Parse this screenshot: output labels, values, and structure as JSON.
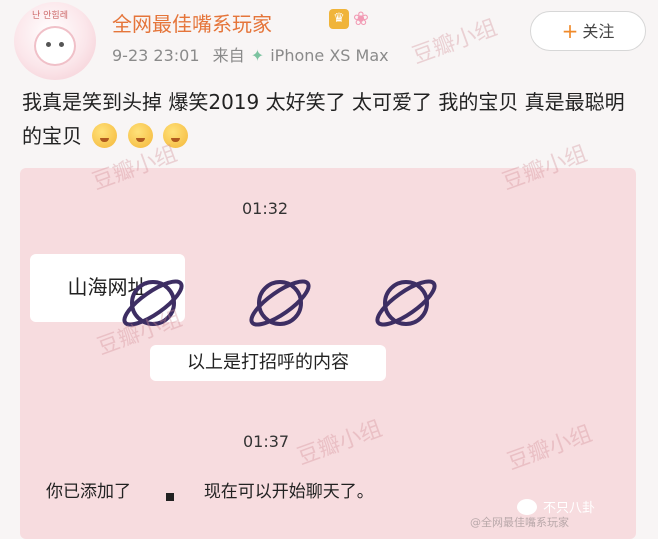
{
  "post": {
    "username": "全网最佳嘴系玩家",
    "avatar_tag": "난 안힘레",
    "timestamp": "9-23 23:01",
    "source_prefix": "来自",
    "device": "iPhone XS Max",
    "follow_label": "关注",
    "text": "我真是笑到头掉 爆笑2019 太好笑了 太可爱了 我的宝贝 真是最聪明的宝贝"
  },
  "chat": {
    "time_top": "01:32",
    "app_label": "山海网址",
    "caption": "以上是打招呼的内容",
    "time_bottom": "01:37",
    "msg_left": "你已添加了",
    "msg_right": "现在可以开始聊天了。"
  },
  "watermarks": [
    "豆瓣小组",
    "豆瓣小组",
    "豆瓣小组",
    "豆瓣小组",
    "豆瓣小组",
    "豆瓣小组"
  ],
  "overlay": {
    "source": "不只八卦",
    "credit": "@全网最佳嘴系玩家"
  },
  "colors": {
    "username": "#e5753a",
    "chat_background": "#f7dcdf",
    "follow_plus": "#f08a2a"
  },
  "icons": [
    "crown-icon",
    "flower-icon",
    "fairy-icon",
    "plus-icon",
    "emoji-icon",
    "planet-icon",
    "chat-icon"
  ]
}
